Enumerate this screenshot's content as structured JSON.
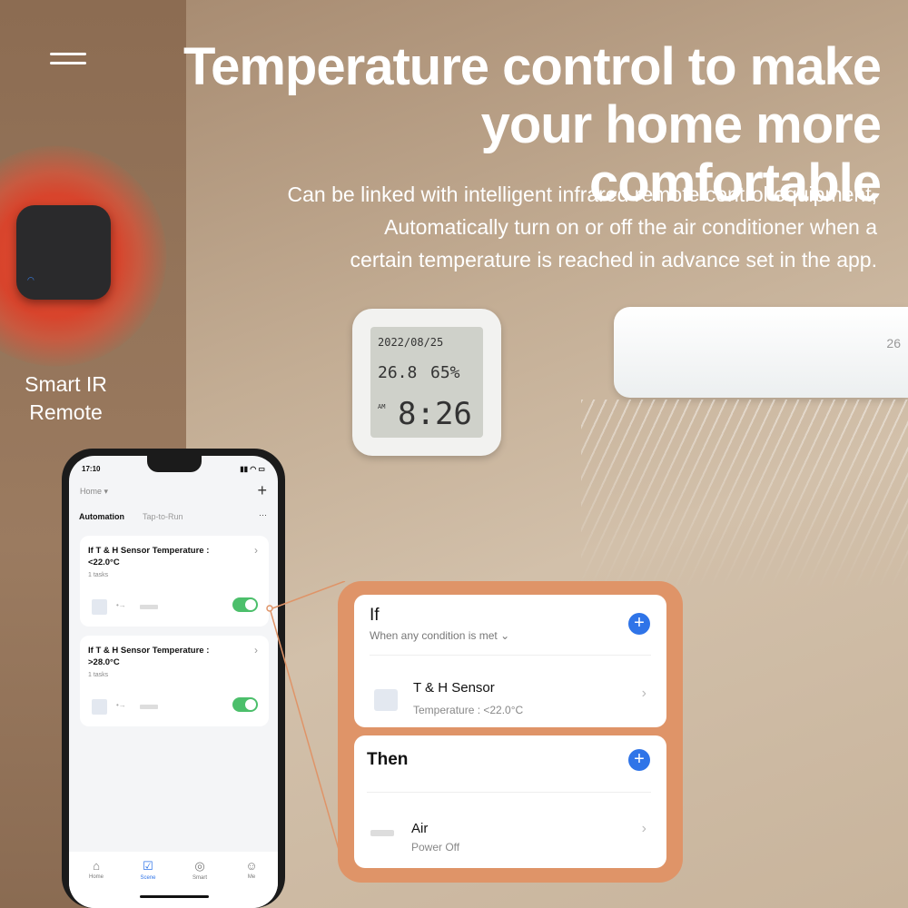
{
  "headline": {
    "title_line1": "Temperature control to make",
    "title_line2": "your home more comfortable",
    "subtitle": [
      "Can be linked with intelligent infrared remote control equipment,",
      "Automatically turn on or off the air conditioner when a",
      "certain temperature is reached in advance set in the app."
    ]
  },
  "remote": {
    "label_line1": "Smart IR",
    "label_line2": "Remote"
  },
  "sensor_display": {
    "date": "2022/08/25",
    "temp": "26.8",
    "humidity": "65%",
    "am": "AM",
    "clock": "8:26"
  },
  "ac_display": "26",
  "phone": {
    "time": "17:10",
    "home": "Home ▾",
    "plus": "+",
    "tabs": [
      "Automation",
      "Tap-to-Run"
    ],
    "more": "···",
    "cards": [
      {
        "title": "If T & H Sensor Temperature :",
        "value": "<22.0°C",
        "tasks": "1 tasks",
        "enabled": true
      },
      {
        "title": "If T & H Sensor Temperature :",
        "value": ">28.0°C",
        "tasks": "1 tasks",
        "enabled": true
      }
    ],
    "nav": [
      {
        "label": "Home",
        "icon": "home-icon"
      },
      {
        "label": "Scene",
        "icon": "scene-checkbox-icon"
      },
      {
        "label": "Smart",
        "icon": "smart-icon"
      },
      {
        "label": "Me",
        "icon": "profile-icon"
      }
    ],
    "nav_active": "Scene"
  },
  "panel": {
    "if_title": "If",
    "if_condition": "When any condition is met ⌄",
    "sensor_name": "T & H Sensor",
    "sensor_detail": "Temperature : <22.0°C",
    "then_title": "Then",
    "device_name": "Air",
    "device_action": "Power Off"
  },
  "colors": {
    "accent": "#2f74e8",
    "toggle": "#4cbf6b",
    "panel": "#df9468",
    "glow": "#d8442c"
  }
}
